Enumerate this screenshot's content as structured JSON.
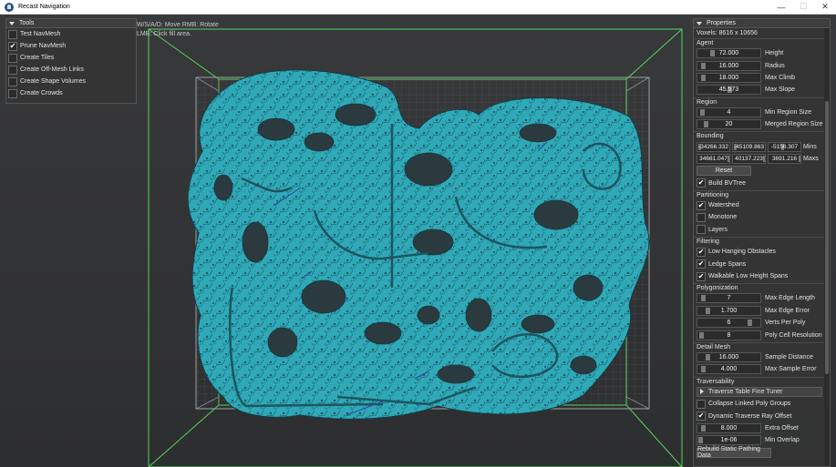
{
  "window": {
    "title": "Recast Navigation",
    "minimize": "—",
    "maximize": "☐",
    "close": "✕"
  },
  "hints": {
    "line1": "W/S/A/D: Move  RMB: Rotate",
    "line2": "LMB: Click fill area."
  },
  "tools": {
    "header": "Tools",
    "items": [
      {
        "label": "Test NavMesh",
        "checked": false
      },
      {
        "label": "Prune NavMesh",
        "checked": true
      },
      {
        "label": "Create Tiles",
        "checked": false
      },
      {
        "label": "Create Off-Mesh Links",
        "checked": false
      },
      {
        "label": "Create Shape Volumes",
        "checked": false
      },
      {
        "label": "Create Crowds",
        "checked": false
      }
    ]
  },
  "properties": {
    "header": "Properties",
    "voxels": "Voxels: 8616 x 10656",
    "agent": {
      "title": "Agent",
      "rows": [
        {
          "value": "72.000",
          "label": "Height",
          "fill": 0.2
        },
        {
          "value": "16.000",
          "label": "Radius",
          "fill": 0.05
        },
        {
          "value": "18.000",
          "label": "Max Climb",
          "fill": 0.04
        },
        {
          "value": "45.573",
          "label": "Max Slope",
          "fill": 0.5
        }
      ]
    },
    "region": {
      "title": "Region",
      "rows": [
        {
          "value": "4",
          "label": "Min Region Size",
          "fill": 0.03
        },
        {
          "value": "20",
          "label": "Merged Region Size",
          "fill": 0.1
        }
      ]
    },
    "bounding": {
      "title": "Bounding",
      "mins": [
        "-34266.332",
        "-45109.863",
        "-5156.307"
      ],
      "mins_label": "Mins",
      "maxs": [
        "34661.047",
        "40137.223",
        "3691.216"
      ],
      "maxs_label": "Maxs",
      "reset": "Reset",
      "build_bvtree": {
        "label": "Build BVTree",
        "checked": true
      }
    },
    "partitioning": {
      "title": "Partitioning",
      "items": [
        {
          "label": "Watershed",
          "checked": true
        },
        {
          "label": "Monotone",
          "checked": false
        },
        {
          "label": "Layers",
          "checked": false
        }
      ]
    },
    "filtering": {
      "title": "Filtering",
      "items": [
        {
          "label": "Low Hanging Obstacles",
          "checked": true
        },
        {
          "label": "Ledge Spans",
          "checked": true
        },
        {
          "label": "Walkable Low Height Spans",
          "checked": true
        }
      ]
    },
    "polygonization": {
      "title": "Polygonization",
      "rows": [
        {
          "value": "7",
          "label": "Max Edge Length",
          "fill": 0.05
        },
        {
          "value": "1.700",
          "label": "Max Edge Error",
          "fill": 0.12
        },
        {
          "value": "6",
          "label": "Verts Per Poly",
          "fill": 0.85
        },
        {
          "value": "8",
          "label": "Poly Cell Resolution",
          "fill": 0.02
        }
      ]
    },
    "detail_mesh": {
      "title": "Detail Mesh",
      "rows": [
        {
          "value": "16.000",
          "label": "Sample Distance",
          "fill": 0.12
        },
        {
          "value": "4.000",
          "label": "Max Sample Error",
          "fill": 0.05
        }
      ]
    },
    "traversability": {
      "title": "Traversability",
      "tuner": "Traverse Table Fine Tuner",
      "collapse": {
        "label": "Collapse Linked Poly Groups",
        "checked": false
      },
      "dynamic": {
        "label": "Dynamic Traverse Ray Offset",
        "checked": true
      },
      "rows": [
        {
          "value": "8.000",
          "label": "Extra Offset",
          "fill": 0.05
        },
        {
          "value": "1e-06",
          "label": "Min Overlap",
          "fill": 0.0
        }
      ],
      "rebuild": "Rebuild Static Pathing Data"
    }
  }
}
